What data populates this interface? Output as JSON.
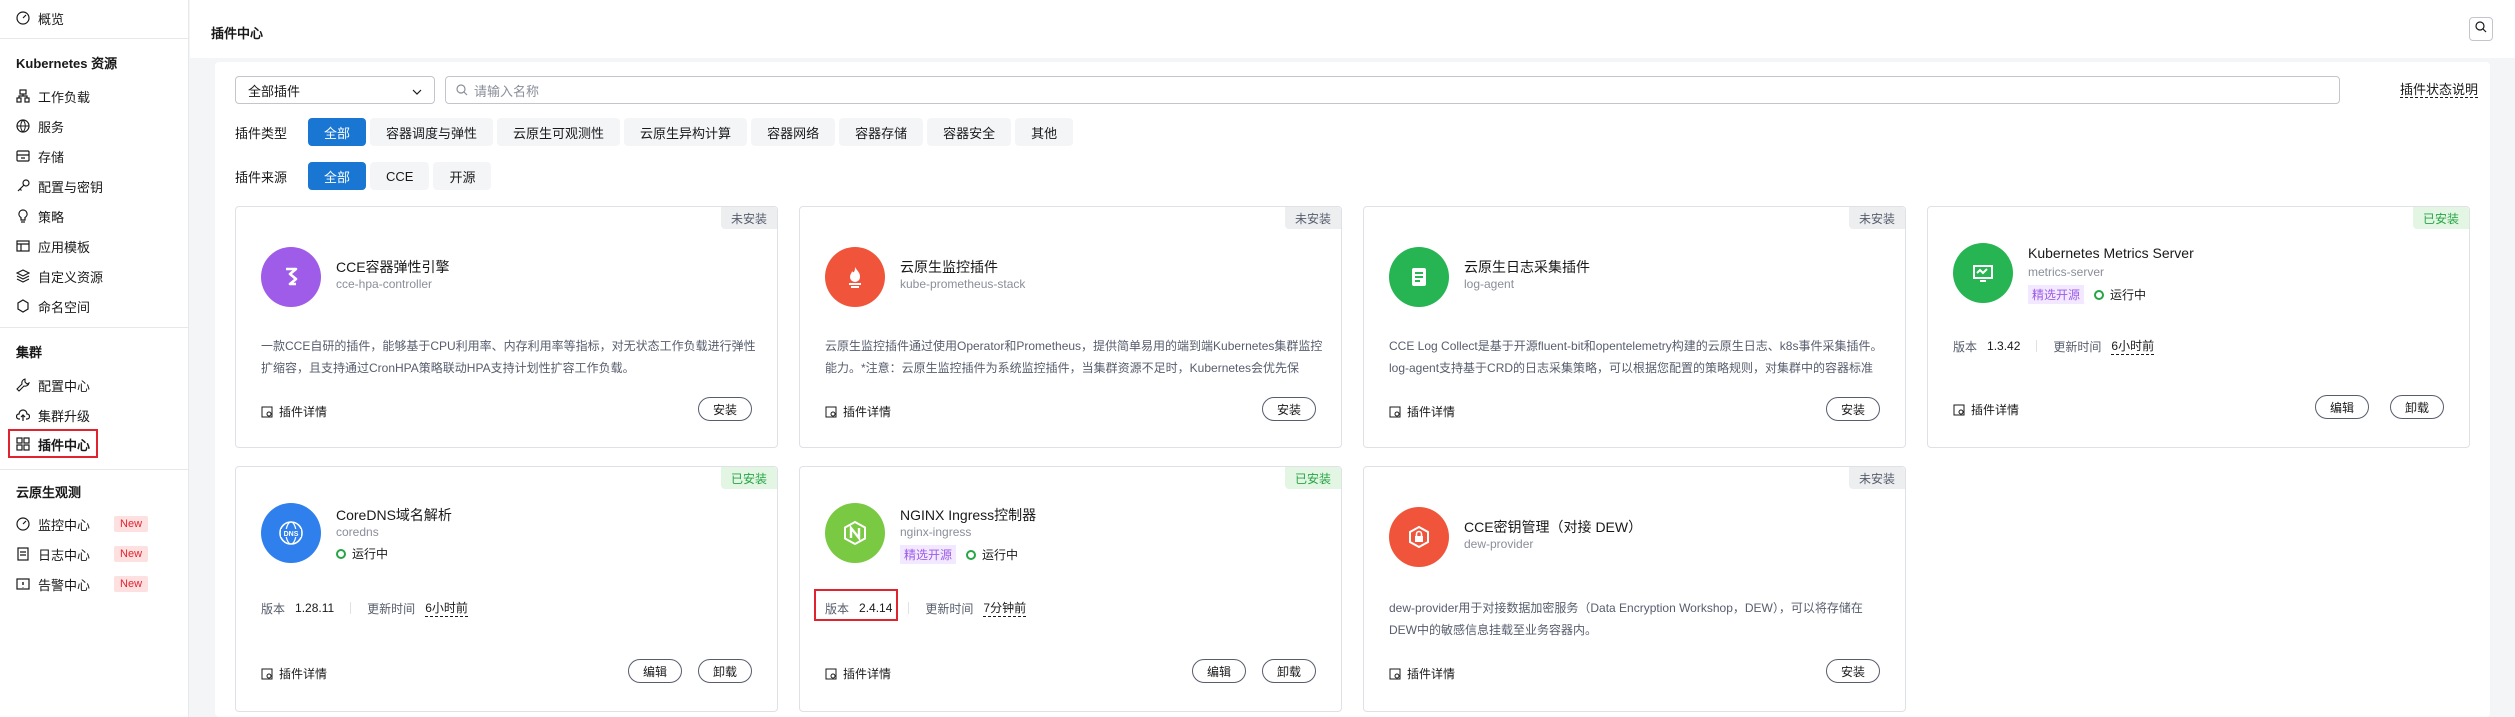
{
  "sidebar": {
    "overview": "概览",
    "group_k8s": "Kubernetes 资源",
    "k8s_items": [
      "工作负载",
      "服务",
      "存储",
      "配置与密钥",
      "策略",
      "应用模板",
      "自定义资源",
      "命名空间"
    ],
    "group_cluster": "集群",
    "cluster_items": [
      "配置中心",
      "集群升级",
      "插件中心"
    ],
    "group_observe": "云原生观测",
    "observe_items": [
      "监控中心",
      "日志中心",
      "告警中心"
    ],
    "new_badge": "New"
  },
  "header": {
    "title": "插件中心"
  },
  "filters": {
    "select_value": "全部插件",
    "search_placeholder": "请输入名称",
    "status_link": "插件状态说明",
    "type_label": "插件类型",
    "types": [
      "全部",
      "容器调度与弹性",
      "云原生可观测性",
      "云原生异构计算",
      "容器网络",
      "容器存储",
      "容器安全",
      "其他"
    ],
    "source_label": "插件来源",
    "sources": [
      "全部",
      "CCE",
      "开源"
    ]
  },
  "labels": {
    "detail": "插件详情",
    "install": "安装",
    "edit": "编辑",
    "uninstall": "卸载",
    "version": "版本",
    "update_time": "更新时间",
    "running": "运行中",
    "open_source_pick": "精选开源"
  },
  "cards": [
    {
      "tag": "未安装",
      "name": "CCE容器弹性引擎",
      "sub": "cce-hpa-controller",
      "desc": "一款CCE自研的插件，能够基于CPU利用率、内存利用率等指标，对无状态工作负载进行弹性扩缩容，且支持通过CronHPA策略联动HPA支持计划性扩容工作负载。",
      "color": "#9f5ce8",
      "icon": "elastic-icon"
    },
    {
      "tag": "未安装",
      "name": "云原生监控插件",
      "sub": "kube-prometheus-stack",
      "desc": "云原生监控插件通过使用Operator和Prometheus，提供简单易用的端到端Kubernetes集群监控能力。*注意：云原生监控插件为系统监控插件，当集群资源不足时，Kubernetes会优先保",
      "color": "#f0553b",
      "icon": "prometheus-icon"
    },
    {
      "tag": "未安装",
      "name": "云原生日志采集插件",
      "sub": "log-agent",
      "desc": "CCE Log Collect是基于开源fluent-bit和opentelemetry构建的云原生日志、k8s事件采集插件。log-agent支持基于CRD的日志采集策略，可以根据您配置的策略规则，对集群中的容器标准",
      "color": "#26b552",
      "icon": "log-icon"
    },
    {
      "tag": "已安装",
      "name": "Kubernetes Metrics Server",
      "sub": "metrics-server",
      "version": "1.3.42",
      "time": "6小时前",
      "color": "#26b552",
      "icon": "metrics-icon"
    },
    {
      "tag": "已安装",
      "name": "CoreDNS域名解析",
      "sub": "coredns",
      "version": "1.28.11",
      "time": "6小时前",
      "color": "#2f80ed",
      "icon": "dns-icon"
    },
    {
      "tag": "已安装",
      "name": "NGINX Ingress控制器",
      "sub": "nginx-ingress",
      "version": "2.4.14",
      "time": "7分钟前",
      "color": "#7ac943",
      "icon": "nginx-icon"
    },
    {
      "tag": "未安装",
      "name": "CCE密钥管理（对接 DEW）",
      "sub": "dew-provider",
      "desc": "dew-provider用于对接数据加密服务（Data Encryption Workshop，DEW），可以将存储在DEW中的敏感信息挂载至业务容器内。",
      "color": "#f0553b",
      "icon": "key-icon"
    }
  ]
}
